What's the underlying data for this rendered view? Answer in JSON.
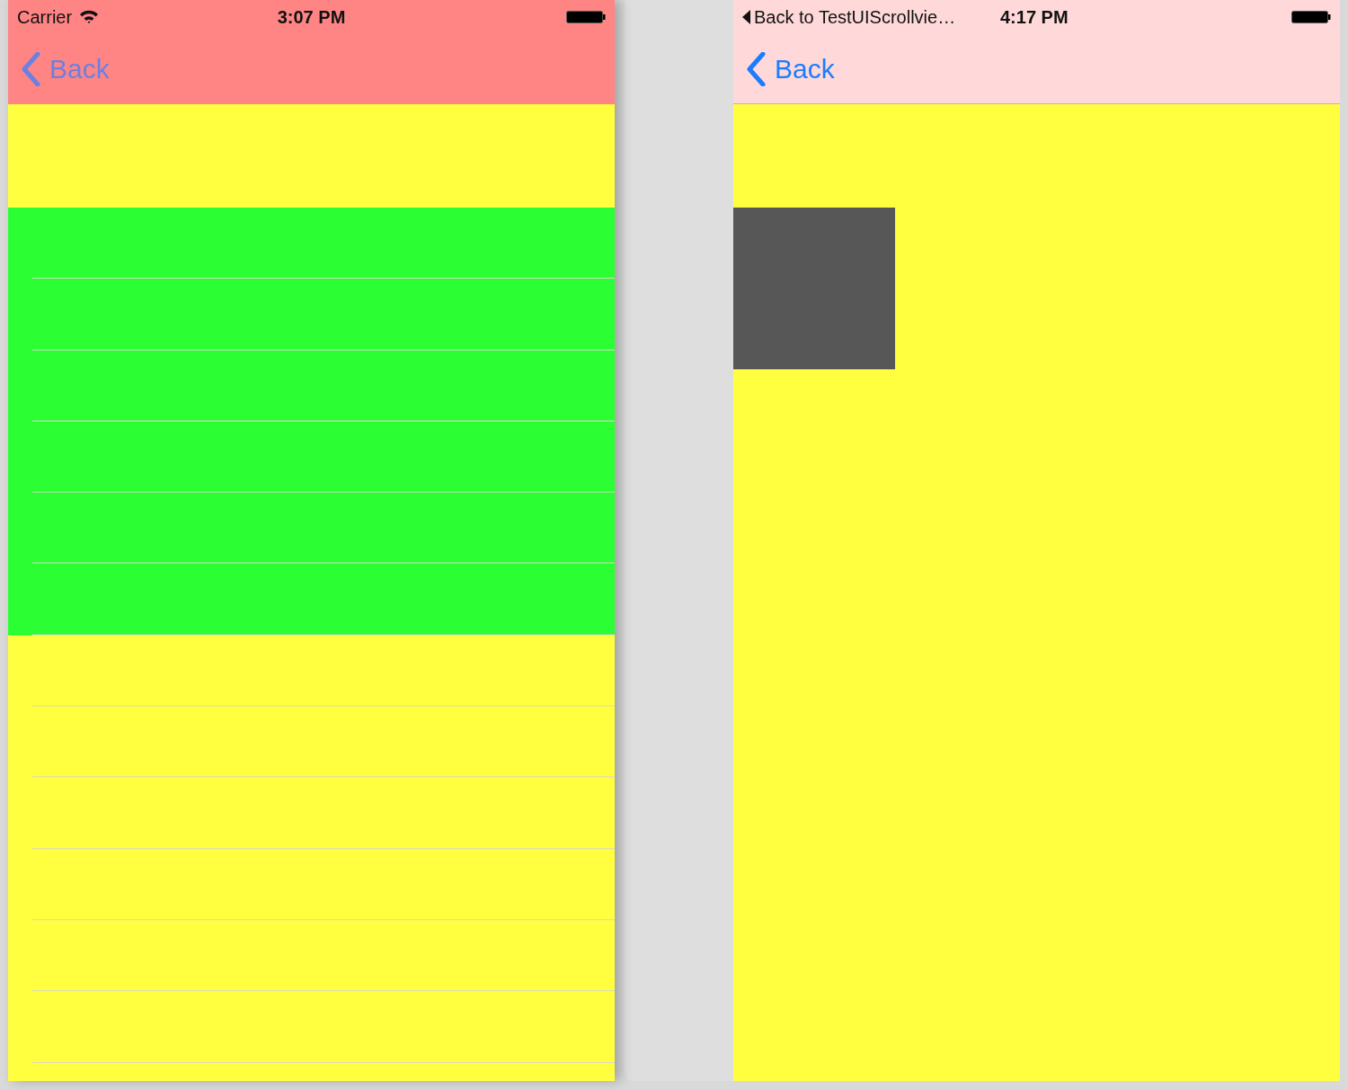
{
  "left_screen": {
    "status_bar": {
      "carrier": "Carrier",
      "time": "3:07 PM"
    },
    "nav_bar": {
      "back": "Back"
    },
    "table": {
      "rows": [
        {
          "color": "#2bff33"
        },
        {
          "color": "#2bff33"
        },
        {
          "color": "#2bff33"
        },
        {
          "color": "#2bff33"
        },
        {
          "color": "#2bff33"
        },
        {
          "color": "#2bff33"
        },
        {
          "color": "#ffff3f"
        },
        {
          "color": "#ffff3f"
        },
        {
          "color": "#ffff3f"
        },
        {
          "color": "#ffff3f"
        },
        {
          "color": "#ffff3f"
        },
        {
          "color": "#ffff3f"
        }
      ]
    }
  },
  "right_screen": {
    "status_bar": {
      "back_to_app": "Back to TestUIScrollvie…",
      "time": "4:17 PM"
    },
    "nav_bar": {
      "back": "Back"
    }
  }
}
